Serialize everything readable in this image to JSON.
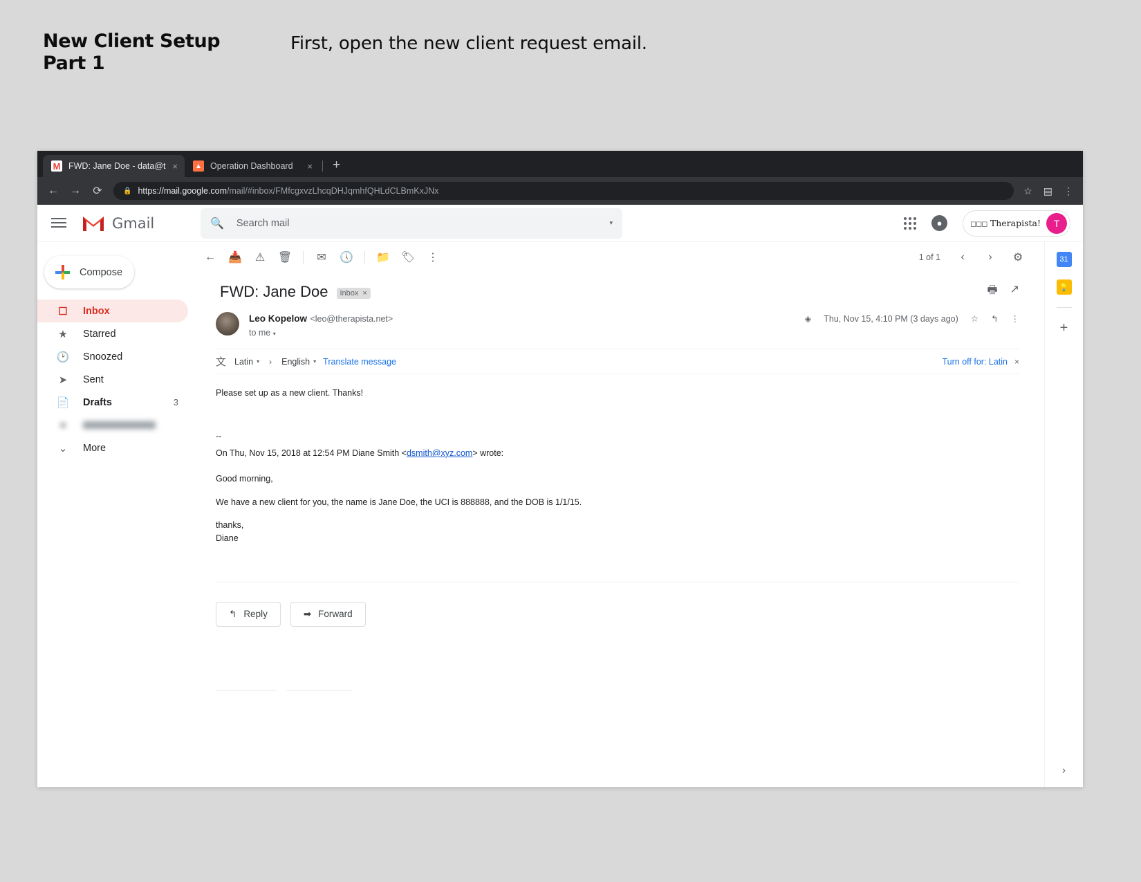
{
  "slide": {
    "title_line1": "New Client Setup",
    "title_line2": "Part 1",
    "instruction": "First, open the new client request email."
  },
  "browser": {
    "tabs": [
      {
        "title": "FWD: Jane Doe - data@therapi",
        "favicon": "gmail-icon",
        "active": true,
        "close": "×"
      },
      {
        "title": "Operation Dashboard",
        "favicon": "dashboard-icon",
        "active": false,
        "close": "×"
      }
    ],
    "new_tab_label": "+",
    "url_scheme": "https://",
    "url_host": "mail.google.com",
    "url_path": "/mail/#inbox/FMfcgxvzLhcqDHJqmhfQHLdCLBmKxJNx",
    "back_icon": "←",
    "forward_icon": "→",
    "reload_icon": "⟳",
    "lock_icon": "🔒",
    "star_icon": "☆",
    "profile_icon": "▤",
    "menu_icon": "⋮"
  },
  "gmail": {
    "logo_text": "Gmail",
    "logo_mark": "M",
    "search": {
      "placeholder": "Search mail",
      "value": "",
      "icon": "⌕",
      "caret": "▾"
    },
    "header_right": {
      "apps_icon": "apps-grid-icon",
      "notifications_icon": "🔔",
      "brand_name": "Therapista!",
      "brand_birds": "◠◡◠",
      "avatar_initial": "T",
      "avatar_color": "#e91e8c"
    },
    "sidebar": {
      "compose_label": "Compose",
      "items": [
        {
          "label": "Inbox",
          "icon": "inbox-icon",
          "count": "",
          "active": true,
          "bold": true
        },
        {
          "label": "Starred",
          "icon": "star-icon",
          "count": "",
          "active": false,
          "bold": false
        },
        {
          "label": "Snoozed",
          "icon": "clock-icon",
          "count": "",
          "active": false,
          "bold": false
        },
        {
          "label": "Sent",
          "icon": "send-icon",
          "count": "",
          "active": false,
          "bold": false
        },
        {
          "label": "Drafts",
          "icon": "draft-icon",
          "count": "3",
          "active": false,
          "bold": true
        }
      ],
      "more_label": "More",
      "more_caret": "⌄"
    },
    "toolbar": {
      "back_icon": "←",
      "archive_icon": "archive-icon",
      "spam_icon": "report-spam-icon",
      "delete_icon": "trash-icon",
      "unread_icon": "mark-unread-icon",
      "snooze_icon": "snooze-clock-icon",
      "move_icon": "move-to-folder-icon",
      "label_icon": "label-tag-icon",
      "more_icon": "⋮",
      "pager_text": "1 of 1",
      "prev_icon": "‹",
      "next_icon": "›",
      "settings_icon": "⚙"
    },
    "message": {
      "subject": "FWD: Jane Doe",
      "label_chip": "Inbox",
      "label_chip_close": "×",
      "print_icon": "🖨",
      "popout_icon": "↗",
      "sender_name": "Leo Kopelow",
      "sender_email": "<leo@therapista.net>",
      "to_line": "to me",
      "to_caret": "▾",
      "attachment_icon": "✐",
      "timestamp": "Thu, Nov 15, 4:10 PM (3 days ago)",
      "star_icon": "☆",
      "reply_arrow_icon": "↰",
      "more_icon": "⋮",
      "translate": {
        "icon": "translate-icon",
        "source_lang": "Latin",
        "arrow": "›",
        "target_lang": "English",
        "translate_link": "Translate message",
        "turn_off_link": "Turn off for: Latin",
        "close": "×",
        "caret": "▾"
      },
      "body": {
        "line1": "Please set up as a new client. Thanks!",
        "separator": "--",
        "quote_intro_pre": "On Thu, Nov 15, 2018 at 12:54 PM Diane Smith <",
        "quote_email": "dsmith@xyz.com",
        "quote_intro_post": "> wrote:",
        "greeting": "Good morning,",
        "main": "We have a new client for you, the name is Jane Doe, the UCI is 888888, and the DOB is 1/1/15.",
        "signoff": "thanks,",
        "signature": "Diane"
      },
      "actions": {
        "reply_label": "Reply",
        "reply_icon": "↰",
        "forward_label": "Forward",
        "forward_icon": "➡"
      }
    },
    "rail": {
      "calendar_label": "31",
      "keep_label": "💡",
      "add_icon": "+",
      "expand_icon": "›"
    }
  }
}
